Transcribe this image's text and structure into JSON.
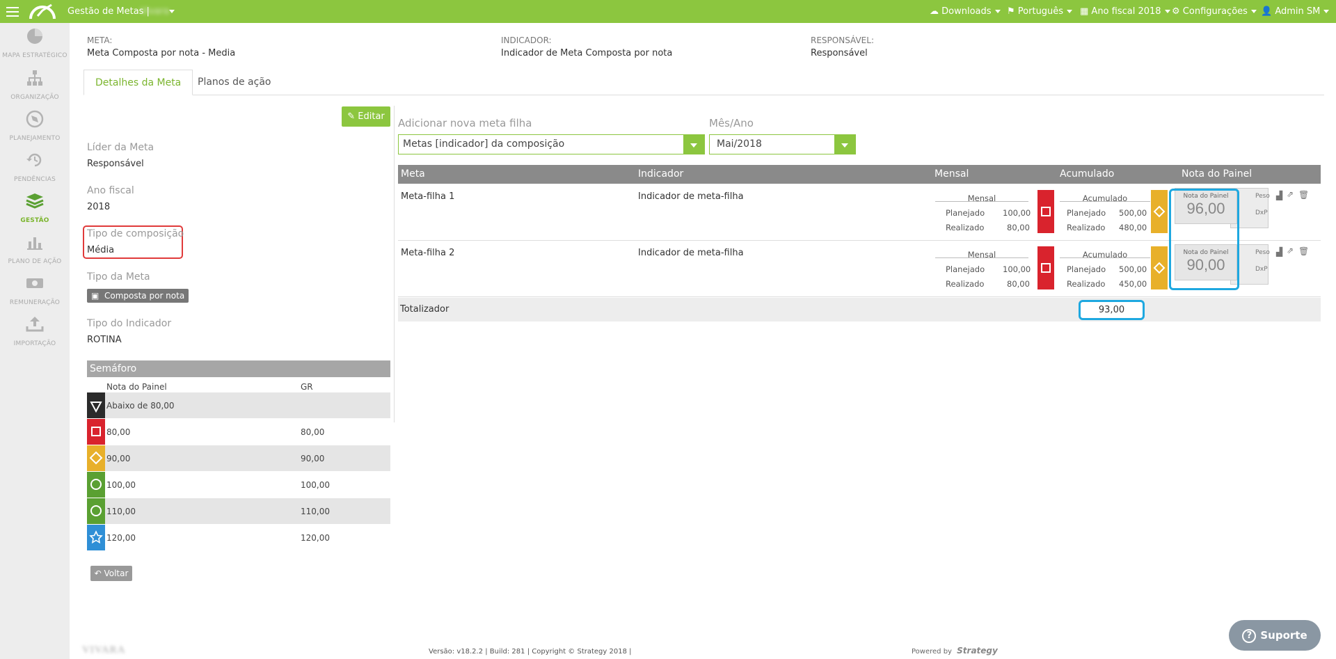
{
  "topbar": {
    "app_title": "Gestão de Metas |",
    "company": "Vivara",
    "menus": [
      "Downloads",
      "Português",
      "Ano fiscal 2018",
      "Configurações",
      "Admin SM"
    ]
  },
  "sidebar": {
    "items": [
      {
        "label": "MAPA ESTRATÉGICO",
        "icon": "pie-chart-icon"
      },
      {
        "label": "ORGANIZAÇÃO",
        "icon": "org-chart-icon"
      },
      {
        "label": "PLANEJAMENTO",
        "icon": "compass-icon"
      },
      {
        "label": "PENDÊNCIAS",
        "icon": "history-icon"
      },
      {
        "label": "GESTÃO",
        "icon": "layers-icon",
        "active": true
      },
      {
        "label": "PLANO DE AÇÃO",
        "icon": "bar-chart-icon"
      },
      {
        "label": "REMUNERAÇÃO",
        "icon": "money-icon"
      },
      {
        "label": "IMPORTAÇÃO",
        "icon": "upload-icon"
      }
    ]
  },
  "header": {
    "meta_label": "META:",
    "meta_value": "Meta Composta por nota - Media",
    "indicador_label": "INDICADOR:",
    "indicador_value": "Indicador de Meta Composta por nota",
    "responsavel_label": "RESPONSÁVEL:",
    "responsavel_value": "Responsável"
  },
  "tabs": [
    "Detalhes da Meta",
    "Planos de ação"
  ],
  "details": {
    "edit_label": "Editar",
    "lider_label": "Líder da Meta",
    "lider_value": "Responsável",
    "ano_label": "Ano fiscal",
    "ano_value": "2018",
    "tipo_comp_label": "Tipo de composição",
    "tipo_comp_value": "Média",
    "tipo_meta_label": "Tipo da Meta",
    "tipo_meta_value": "Composta por nota",
    "tipo_ind_label": "Tipo do Indicador",
    "tipo_ind_value": "ROTINA",
    "back_label": "Voltar"
  },
  "semaforo": {
    "title": "Semáforo",
    "col1": "Nota do Painel",
    "col2": "GR",
    "rows": [
      {
        "icon": "triangle-down-icon",
        "color": "#2b2b2b",
        "v1": "Abaixo de 80,00",
        "v2": ""
      },
      {
        "icon": "square-icon",
        "color": "#d9232d",
        "v1": "80,00",
        "v2": "80,00"
      },
      {
        "icon": "diamond-icon",
        "color": "#e8b02a",
        "v1": "90,00",
        "v2": "90,00"
      },
      {
        "icon": "circle-icon",
        "color": "#5aa032",
        "v1": "100,00",
        "v2": "100,00"
      },
      {
        "icon": "circle-icon",
        "color": "#5aa032",
        "v1": "110,00",
        "v2": "110,00"
      },
      {
        "icon": "star-icon",
        "color": "#2f8fd6",
        "v1": "120,00",
        "v2": "120,00"
      }
    ]
  },
  "children": {
    "add_label": "Adicionar nova meta filha",
    "add_select": "Metas [indicador] da composição",
    "month_label": "Mês/Ano",
    "month_select": "Mai/2018",
    "cols": [
      "Meta",
      "Indicador",
      "Mensal",
      "Acumulado",
      "Nota do Painel"
    ],
    "rows": [
      {
        "meta": "Meta-filha 1",
        "indicador": "Indicador de meta-filha",
        "mensal_title": "Mensal",
        "planejado_label": "Planejado",
        "realizado_label": "Realizado",
        "mensal_planejado": "100,00",
        "mensal_realizado": "80,00",
        "mensal_status_color": "#d9232d",
        "mensal_status_icon": "square-icon",
        "acum_title": "Acumulado",
        "acum_planejado": "500,00",
        "acum_realizado": "480,00",
        "acum_status_color": "#e8b02a",
        "acum_status_icon": "diamond-icon",
        "nota_label": "Nota do Painel",
        "nota_value": "96,00",
        "peso_label": "Peso",
        "dxp_label": "DxP"
      },
      {
        "meta": "Meta-filha 2",
        "indicador": "Indicador de meta-filha",
        "mensal_title": "Mensal",
        "planejado_label": "Planejado",
        "realizado_label": "Realizado",
        "mensal_planejado": "100,00",
        "mensal_realizado": "80,00",
        "mensal_status_color": "#d9232d",
        "mensal_status_icon": "square-icon",
        "acum_title": "Acumulado",
        "acum_planejado": "500,00",
        "acum_realizado": "450,00",
        "acum_status_color": "#e8b02a",
        "acum_status_icon": "diamond-icon",
        "nota_label": "Nota do Painel",
        "nota_value": "90,00",
        "peso_label": "Peso",
        "dxp_label": "DxP"
      }
    ],
    "total_label": "Totalizador",
    "total_value": "93,00"
  },
  "footer": {
    "brand": "VIVARA",
    "version": "Versão: v18.2.2 | Build: 281 | Copyright © Strategy 2018 |",
    "powered": "Powered by",
    "powered_brand": "Strategy",
    "support": "Suporte"
  },
  "colors": {
    "accent": "#8cc63f",
    "highlight_blue": "#1ea8e0",
    "highlight_red": "#e03a3a"
  }
}
